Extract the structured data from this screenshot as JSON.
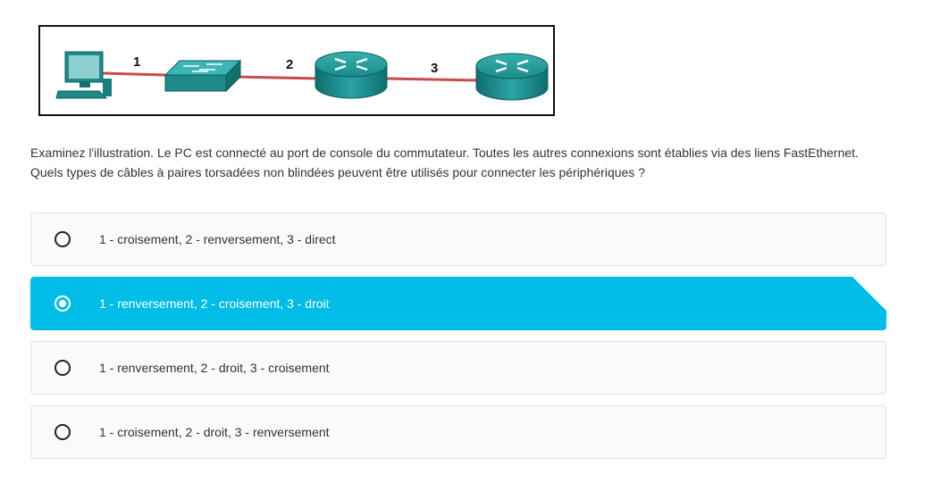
{
  "exhibit": {
    "cable_labels": [
      "1",
      "2",
      "3"
    ],
    "devices": [
      "pc-icon",
      "switch-icon",
      "router-icon",
      "router-icon"
    ],
    "cable_color": "#c94a4a",
    "device_color": "#1e8a8a"
  },
  "question": {
    "text": "Examinez l'illustration. Le PC est connecté au port de console du commutateur. Toutes les autres connexions sont établies via des liens FastEthernet. Quels types de câbles à paires torsadées non blindées peuvent être utilisés pour connecter les périphériques ?"
  },
  "options": [
    {
      "label": "1 - croisement, 2 - renversement, 3 - direct",
      "selected": false
    },
    {
      "label": "1 - renversement, 2 - croisement, 3 - droit",
      "selected": true
    },
    {
      "label": "1 - renversement, 2 - droit, 3 - croisement",
      "selected": false
    },
    {
      "label": "1 - croisement, 2 - droit, 3 - renversement",
      "selected": false
    }
  ],
  "colors": {
    "selected_bg": "#00bde8",
    "option_bg": "#fafafa",
    "option_border": "#e3e3e3"
  }
}
